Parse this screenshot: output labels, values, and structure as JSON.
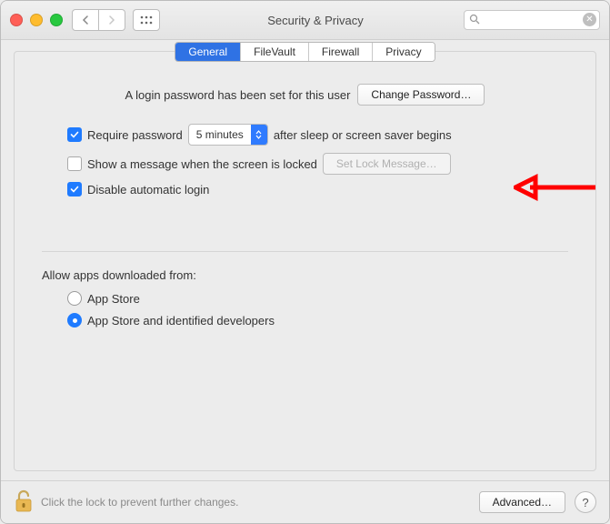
{
  "window": {
    "title": "Security & Privacy"
  },
  "search": {
    "placeholder": ""
  },
  "tabs": [
    {
      "label": "General",
      "active": true
    },
    {
      "label": "FileVault",
      "active": false
    },
    {
      "label": "Firewall",
      "active": false
    },
    {
      "label": "Privacy",
      "active": false
    }
  ],
  "password_set_text": "A login password has been set for this user",
  "change_password_label": "Change Password…",
  "require_password": {
    "checked": true,
    "prefix": "Require password",
    "delay_value": "5 minutes",
    "suffix": "after sleep or screen saver begins"
  },
  "show_message": {
    "checked": false,
    "label": "Show a message when the screen is locked",
    "button": "Set Lock Message…",
    "button_disabled": true
  },
  "disable_auto_login": {
    "checked": true,
    "label": "Disable automatic login"
  },
  "downloads_section": {
    "title": "Allow apps downloaded from:",
    "options": [
      {
        "label": "App Store",
        "checked": false
      },
      {
        "label": "App Store and identified developers",
        "checked": true
      }
    ]
  },
  "footer": {
    "lock_text": "Click the lock to prevent further changes.",
    "advanced_label": "Advanced…"
  }
}
